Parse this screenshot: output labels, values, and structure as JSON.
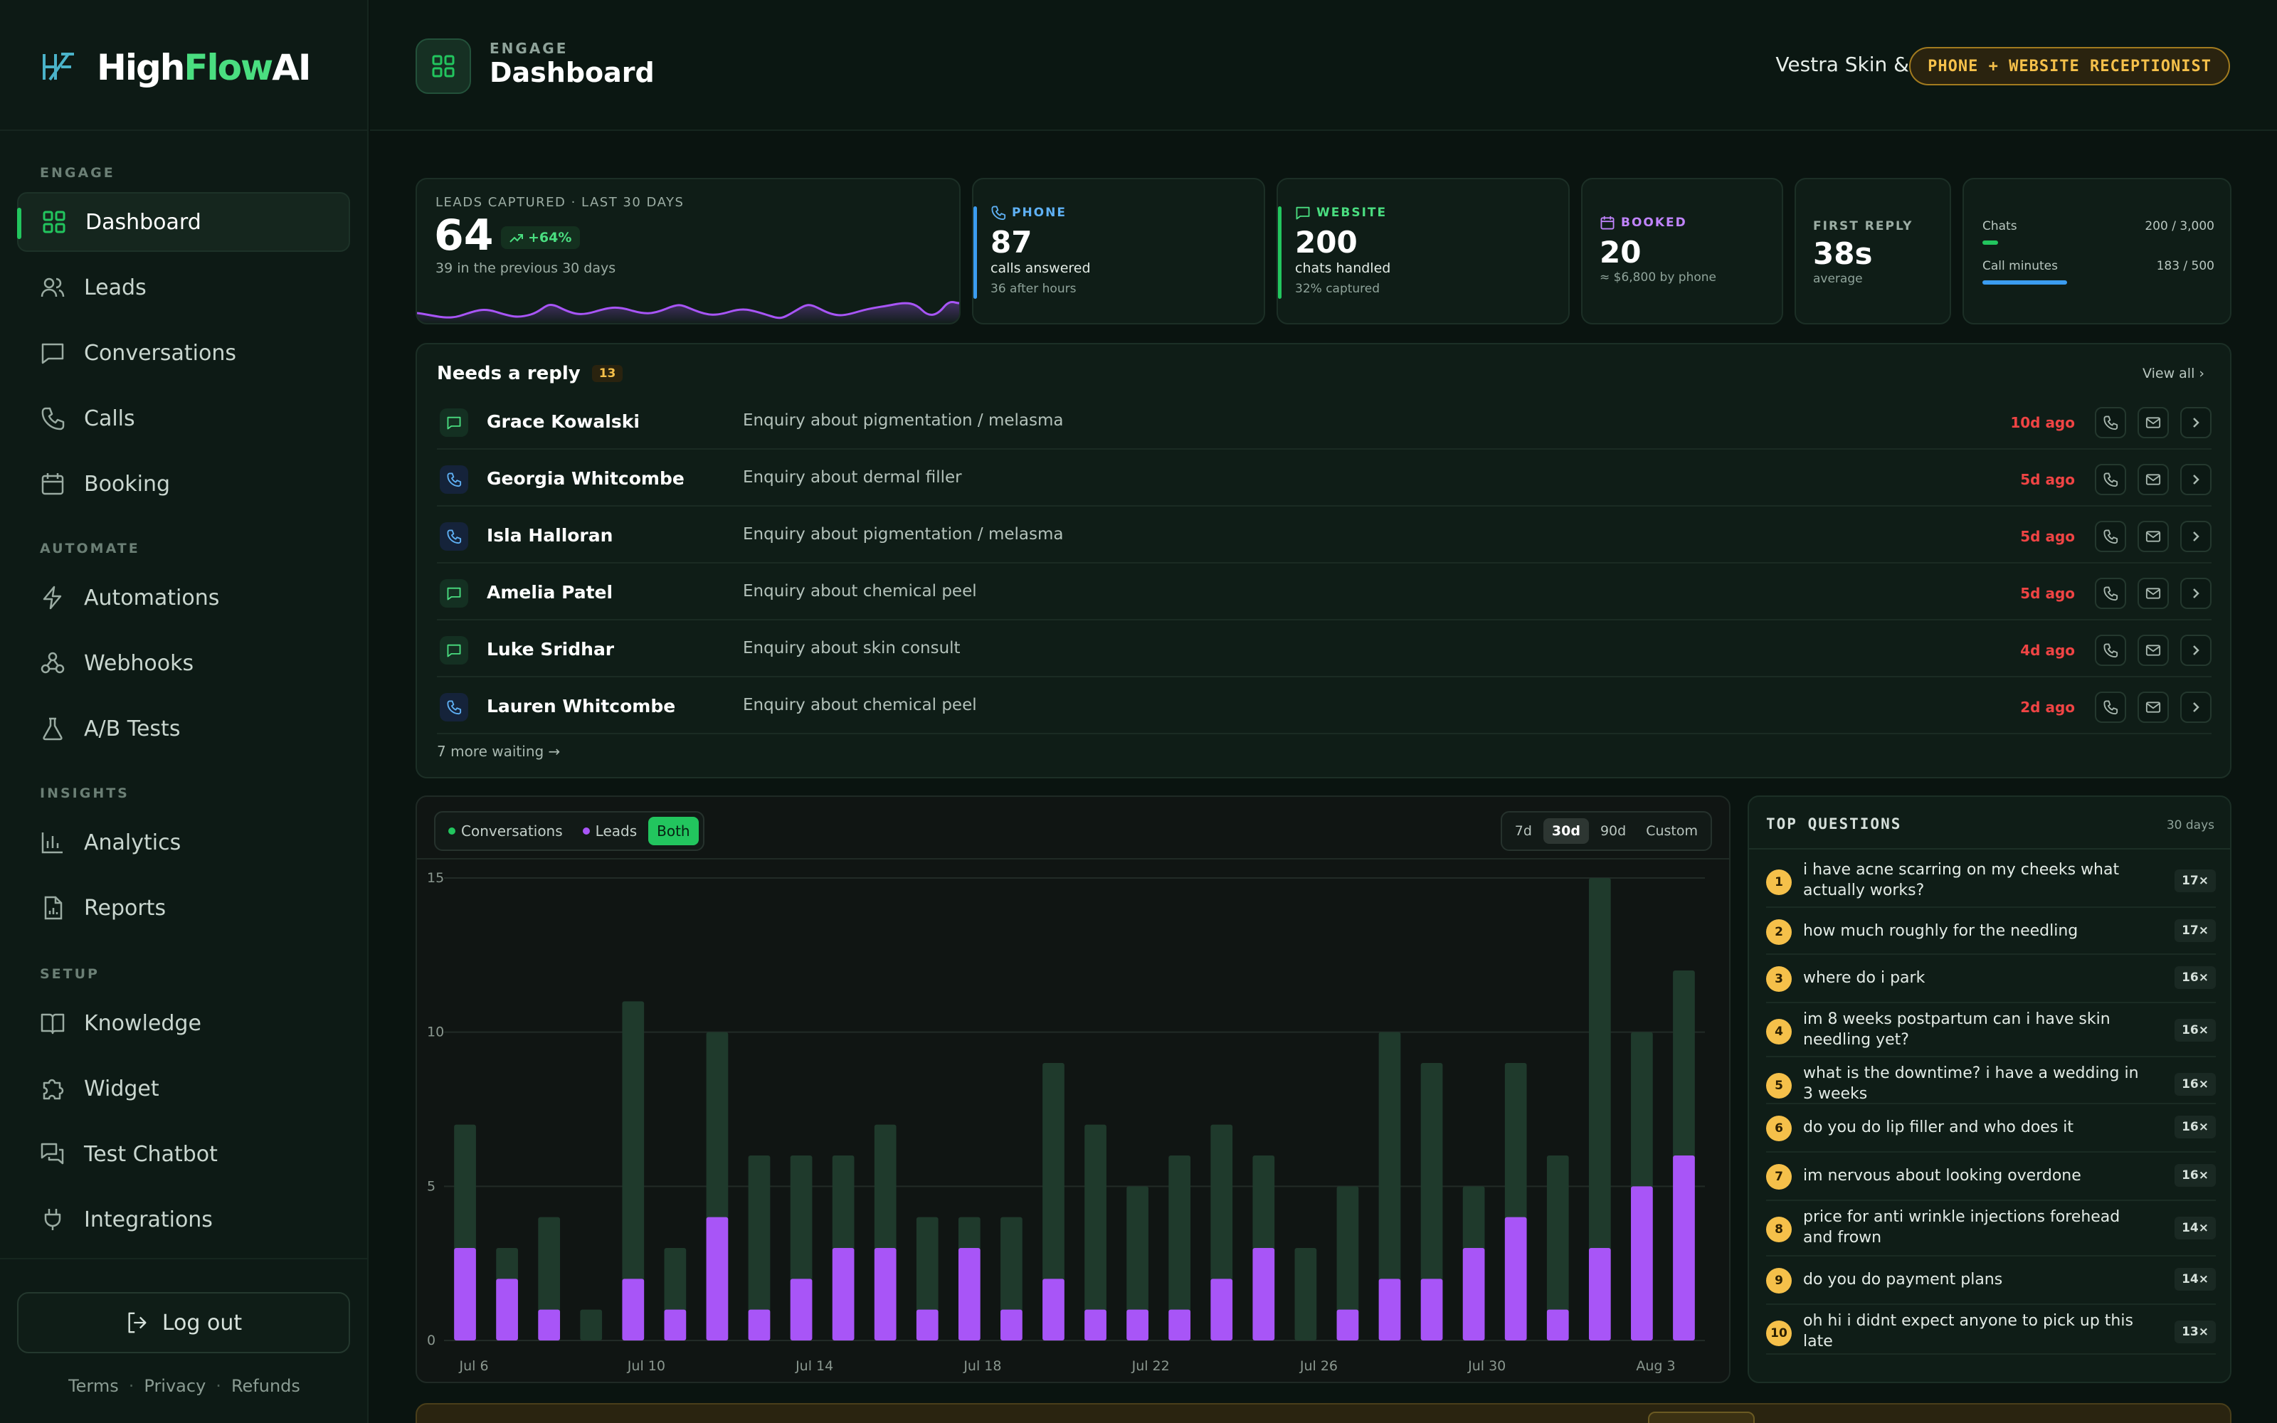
{
  "brand": {
    "name_prefix": "High",
    "name_highlight": "Flow",
    "name_suffix": "AI"
  },
  "sidebar": {
    "sections": [
      {
        "label": "ENGAGE",
        "items": [
          "Dashboard",
          "Leads",
          "Conversations",
          "Calls",
          "Booking"
        ]
      },
      {
        "label": "AUTOMATE",
        "items": [
          "Automations",
          "Webhooks",
          "A/B Tests"
        ]
      },
      {
        "label": "INSIGHTS",
        "items": [
          "Analytics",
          "Reports"
        ]
      },
      {
        "label": "SETUP",
        "items": [
          "Knowledge",
          "Widget",
          "Test Chatbot",
          "Integrations"
        ]
      }
    ],
    "active_item": "Dashboard",
    "logout_label": "Log out",
    "footer_links": [
      "Terms",
      "Privacy",
      "Refunds"
    ]
  },
  "header": {
    "eyebrow": "ENGAGE",
    "title": "Dashboard",
    "business_name": "Vestra Skin & Laser",
    "plan_badge": "PHONE + WEBSITE RECEPTIONIST"
  },
  "stats": {
    "leads": {
      "label": "LEADS CAPTURED · LAST 30 DAYS",
      "value": "64",
      "trend": "+64%",
      "sub": "39 in the previous 30 days"
    },
    "phone": {
      "label": "PHONE",
      "value": "87",
      "line1": "calls answered",
      "line2": "36 after hours"
    },
    "website": {
      "label": "WEBSITE",
      "value": "200",
      "line1": "chats handled",
      "line2": "32% captured"
    },
    "booked": {
      "label": "BOOKED",
      "value": "20",
      "line1": "≈ $6,800 by phone"
    },
    "first_reply": {
      "label": "FIRST REPLY",
      "value": "38s",
      "line1": "average"
    },
    "usage": [
      {
        "label": "Chats",
        "value": "200 / 3,000",
        "fraction": 0.067,
        "color": "#22c55e"
      },
      {
        "label": "Call minutes",
        "value": "183 / 500",
        "fraction": 0.366,
        "color": "#3b9cf0"
      }
    ]
  },
  "needs_reply": {
    "title": "Needs a reply",
    "count": "13",
    "view_all": "View all",
    "more": "7 more waiting →",
    "rows": [
      {
        "channel": "chat",
        "name": "Grace Kowalski",
        "desc": "Enquiry about pigmentation / melasma",
        "ago": "10d ago"
      },
      {
        "channel": "phone",
        "name": "Georgia Whitcombe",
        "desc": "Enquiry about dermal filler",
        "ago": "5d ago"
      },
      {
        "channel": "phone",
        "name": "Isla Halloran",
        "desc": "Enquiry about pigmentation / melasma",
        "ago": "5d ago"
      },
      {
        "channel": "chat",
        "name": "Amelia Patel",
        "desc": "Enquiry about chemical peel",
        "ago": "5d ago"
      },
      {
        "channel": "chat",
        "name": "Luke Sridhar",
        "desc": "Enquiry about skin consult",
        "ago": "4d ago"
      },
      {
        "channel": "phone",
        "name": "Lauren Whitcombe",
        "desc": "Enquiry about chemical peel",
        "ago": "2d ago"
      }
    ]
  },
  "chart_controls": {
    "series_toggle": [
      {
        "label": "Conversations",
        "color": "#22c55e"
      },
      {
        "label": "Leads",
        "color": "#a855f7"
      },
      {
        "label": "Both",
        "active": true
      }
    ],
    "ranges": [
      "7d",
      "30d",
      "90d",
      "Custom"
    ],
    "active_range": "30d"
  },
  "chart_data": {
    "type": "bar",
    "stacked_overlay": true,
    "ylim": [
      0,
      15
    ],
    "yticks": [
      0,
      5,
      10,
      15
    ],
    "categories": [
      "Jul 6",
      "Jul 7",
      "Jul 8",
      "Jul 9",
      "Jul 10",
      "Jul 11",
      "Jul 12",
      "Jul 13",
      "Jul 14",
      "Jul 15",
      "Jul 16",
      "Jul 17",
      "Jul 18",
      "Jul 19",
      "Jul 20",
      "Jul 21",
      "Jul 22",
      "Jul 23",
      "Jul 24",
      "Jul 25",
      "Jul 26",
      "Jul 27",
      "Jul 28",
      "Jul 29",
      "Jul 30",
      "Jul 31",
      "Aug 1",
      "Aug 2",
      "Aug 3",
      "Aug 4"
    ],
    "xtick_labels": [
      "Jul 6",
      "Jul 10",
      "Jul 14",
      "Jul 18",
      "Jul 22",
      "Jul 26",
      "Jul 30",
      "Aug 3"
    ],
    "series": [
      {
        "name": "Conversations",
        "color": "#1f3a2c",
        "values": [
          7,
          3,
          4,
          1,
          11,
          3,
          10,
          6,
          6,
          6,
          7,
          4,
          4,
          4,
          9,
          7,
          5,
          6,
          7,
          6,
          3,
          5,
          10,
          9,
          5,
          9,
          6,
          15,
          10,
          12
        ]
      },
      {
        "name": "Leads",
        "color": "#a855f7",
        "values": [
          3,
          2,
          1,
          0,
          2,
          1,
          4,
          1,
          2,
          3,
          3,
          1,
          3,
          1,
          2,
          1,
          1,
          1,
          2,
          3,
          0,
          1,
          2,
          2,
          3,
          4,
          1,
          3,
          5,
          6
        ]
      }
    ],
    "grid": true
  },
  "top_questions": {
    "title": "TOP QUESTIONS",
    "range": "30 days",
    "items": [
      {
        "n": "1",
        "text": "i have acne scarring on my cheeks what actually works?",
        "count": "17×"
      },
      {
        "n": "2",
        "text": "how much roughly for the needling",
        "count": "17×"
      },
      {
        "n": "3",
        "text": "where do i park",
        "count": "16×"
      },
      {
        "n": "4",
        "text": "im 8 weeks postpartum can i have skin needling yet?",
        "count": "16×"
      },
      {
        "n": "5",
        "text": "what is the downtime? i have a wedding in 3 weeks",
        "count": "16×"
      },
      {
        "n": "6",
        "text": "do you do lip filler and who does it",
        "count": "16×"
      },
      {
        "n": "7",
        "text": "im nervous about looking overdone",
        "count": "16×"
      },
      {
        "n": "8",
        "text": "price for anti wrinkle injections forehead and frown",
        "count": "14×"
      },
      {
        "n": "9",
        "text": "do you do payment plans",
        "count": "14×"
      },
      {
        "n": "10",
        "text": "oh hi i didnt expect anyone to pick up this late",
        "count": "13×"
      }
    ]
  }
}
